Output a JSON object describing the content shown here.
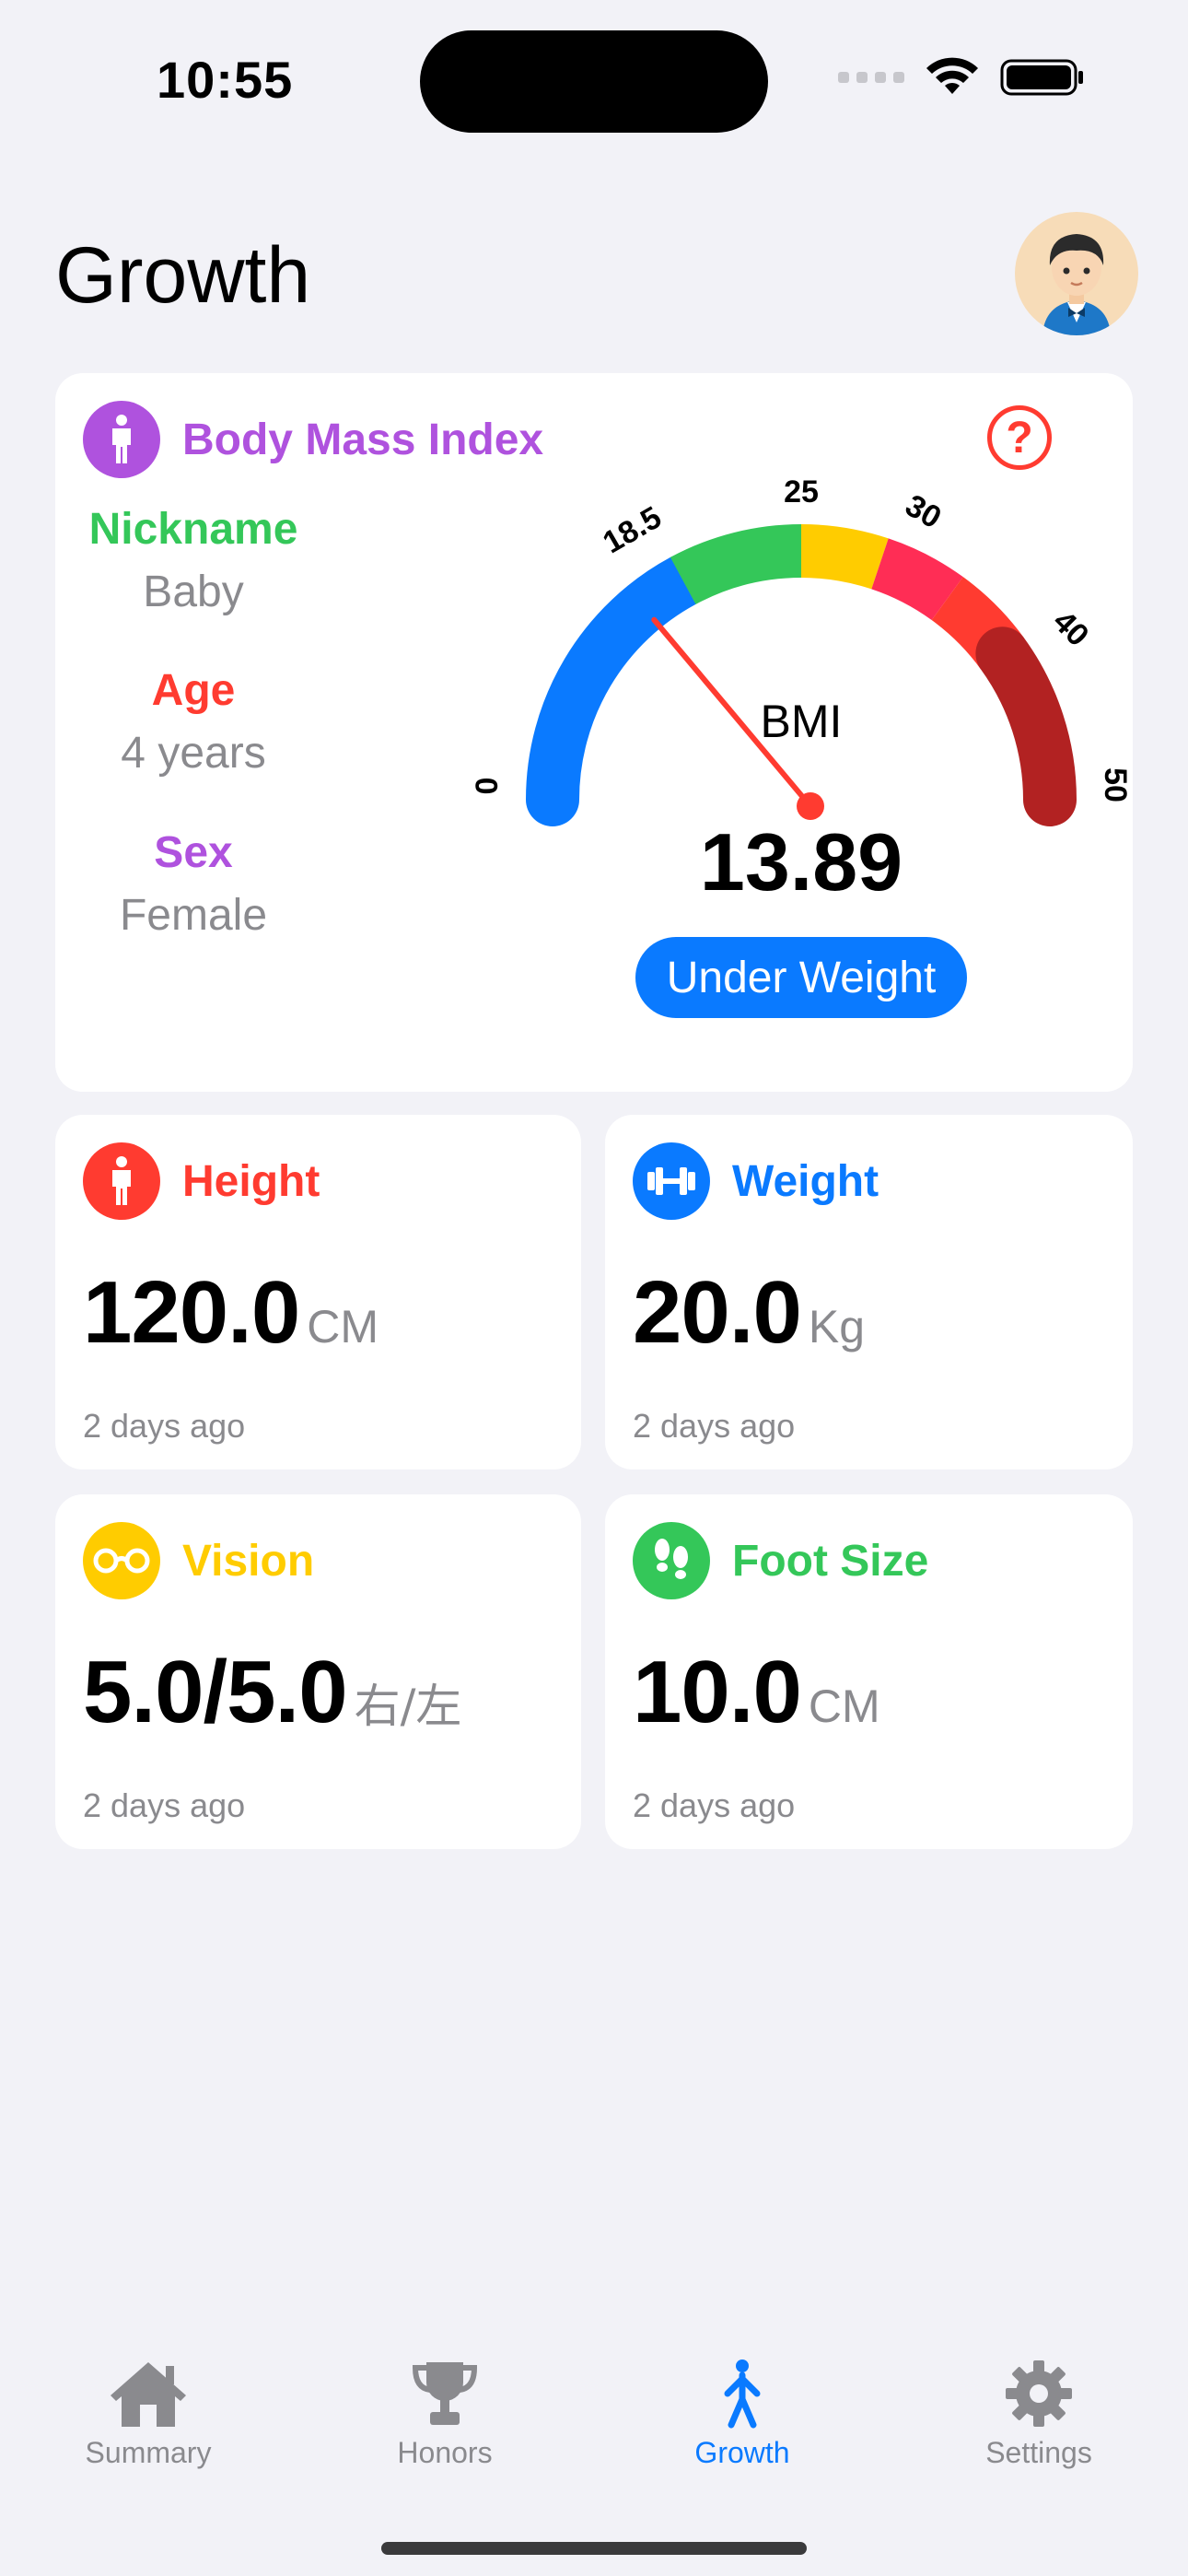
{
  "status_bar": {
    "time": "10:55"
  },
  "header": {
    "title": "Growth"
  },
  "bmi_card": {
    "title": "Body Mass Index",
    "help_label": "?",
    "nickname_label": "Nickname",
    "nickname_value": "Baby",
    "age_label": "Age",
    "age_value": "4 years",
    "sex_label": "Sex",
    "sex_value": "Female",
    "gauge_label": "BMI",
    "gauge_ticks": [
      "0",
      "18.5",
      "25",
      "30",
      "40",
      "50"
    ],
    "value": "13.89",
    "status": "Under Weight",
    "gauge_value": 13.89,
    "gauge_min": 0,
    "gauge_max": 50
  },
  "metrics": {
    "height": {
      "title": "Height",
      "value": "120.0",
      "unit": "CM",
      "time": "2 days ago"
    },
    "weight": {
      "title": "Weight",
      "value": "20.0",
      "unit": "Kg",
      "time": "2 days ago"
    },
    "vision": {
      "title": "Vision",
      "value": "5.0/5.0",
      "unit": "右/左",
      "time": "2 days ago"
    },
    "foot": {
      "title": "Foot Size",
      "value": "10.0",
      "unit": "CM",
      "time": "2 days ago"
    }
  },
  "tabs": [
    {
      "label": "Summary",
      "icon": "house-icon"
    },
    {
      "label": "Honors",
      "icon": "trophy-icon"
    },
    {
      "label": "Growth",
      "icon": "figure-walk-icon",
      "active": true
    },
    {
      "label": "Settings",
      "icon": "gear-icon"
    }
  ],
  "colors": {
    "accent": "#0a7aff",
    "purple": "#af52de",
    "green": "#34c759",
    "red": "#ff3b30",
    "yellow": "#ffcc00",
    "background": "#f2f2f7"
  }
}
